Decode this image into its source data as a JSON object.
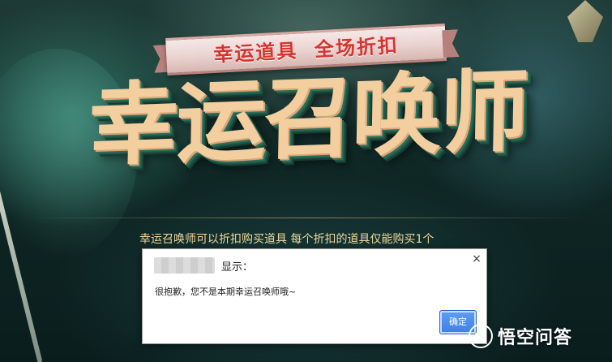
{
  "banner": {
    "ribbon_text": "幸运道具  全场折扣",
    "title": "幸运召唤师",
    "info_text": "幸运召唤师可以折扣购买道具 每个折扣的道具仅能购买1个"
  },
  "dialog": {
    "title_suffix": "显示：",
    "close_label": "×",
    "message": "很抱歉，您不是本期幸运召唤师哦~",
    "ok_label": "确定"
  },
  "watermark": {
    "text": "悟空问答",
    "icon": "wukong-logo-icon"
  },
  "colors": {
    "title_gold": "#f3cfa0",
    "ribbon_red": "#d8342f",
    "info_gold": "#f2d79a",
    "ok_blue": "#3d7fe4"
  }
}
